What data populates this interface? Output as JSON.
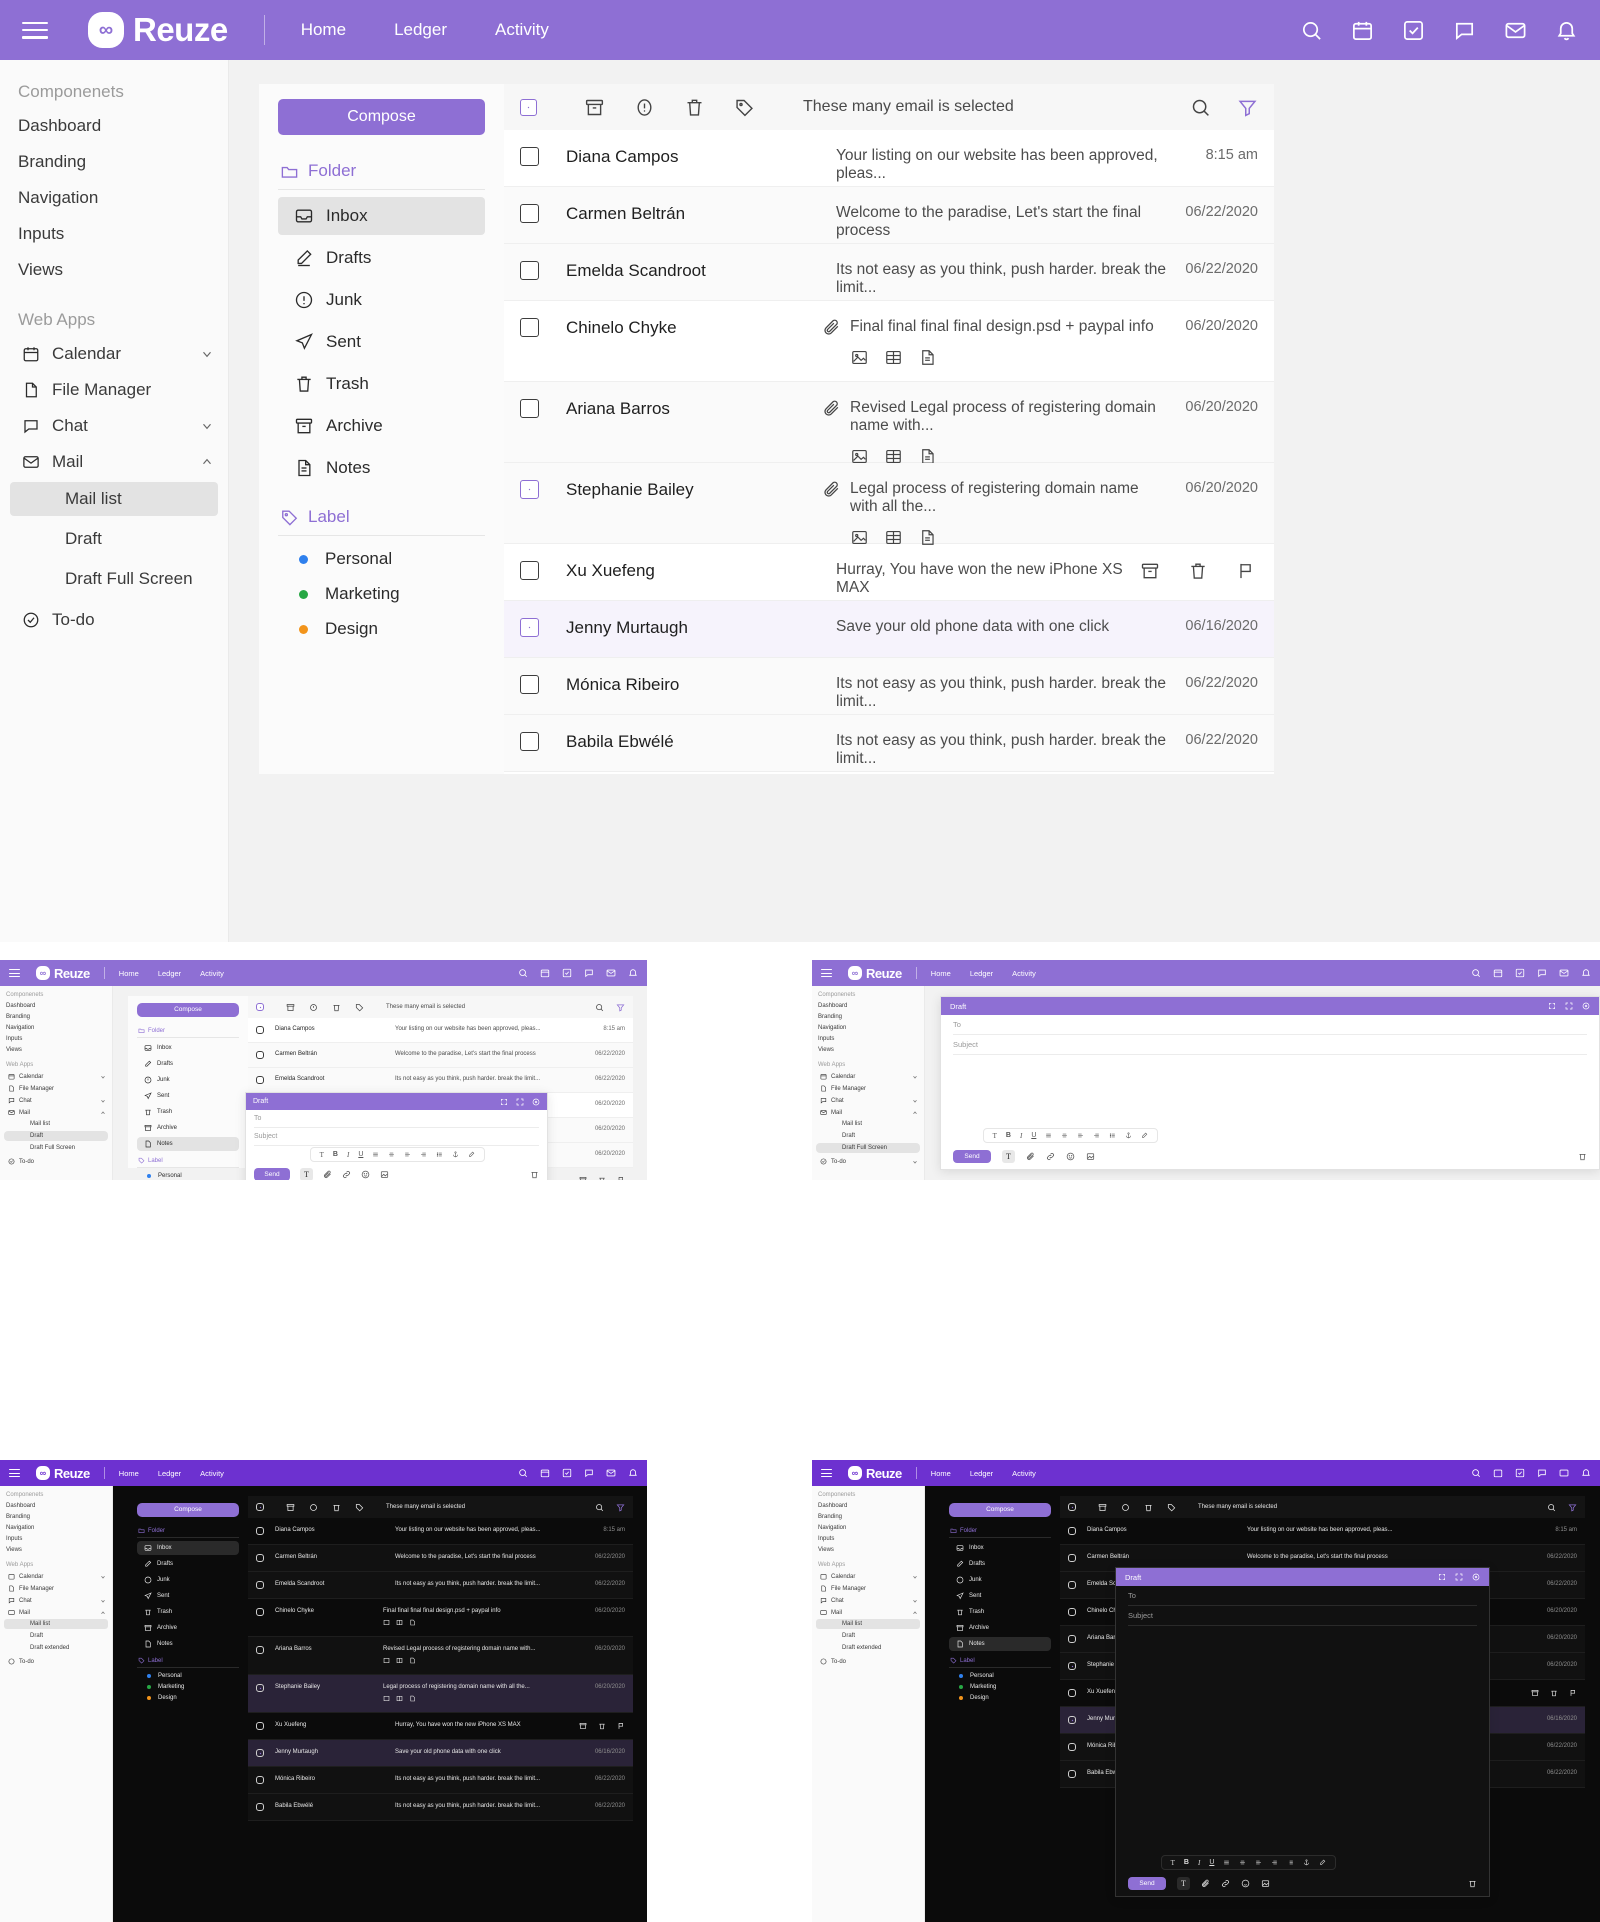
{
  "brand": {
    "name": "Reuze",
    "logo_glyph": "∞",
    "accent": "#8e6fd4",
    "header_bg": "#8e6fd4",
    "dark_header_bg": "#6d31d0"
  },
  "header": {
    "nav": [
      "Home",
      "Ledger",
      "Activity"
    ],
    "icons": [
      "search-icon",
      "calendar-icon",
      "tasks-icon",
      "chat-icon",
      "mail-icon",
      "bell-icon"
    ]
  },
  "sidebar": {
    "section_components": "Componenets",
    "components": [
      "Dashboard",
      "Branding",
      "Navigation",
      "Inputs",
      "Views"
    ],
    "section_webapps": "Web Apps",
    "webapps": [
      {
        "label": "Calendar",
        "icon": "calendar-icon",
        "chevron": "down"
      },
      {
        "label": "File Manager",
        "icon": "file-icon",
        "chevron": "none"
      },
      {
        "label": "Chat",
        "icon": "chat-icon",
        "chevron": "down"
      },
      {
        "label": "Mail",
        "icon": "mail-icon",
        "chevron": "up"
      }
    ],
    "mail_children": [
      "Mail list",
      "Draft",
      "Draft Full Screen"
    ],
    "mail_children_alt": [
      "Mail list",
      "Draft",
      "Draft extended"
    ],
    "todo": {
      "label": "To-do",
      "icon": "check-circle-icon",
      "chevron": "none"
    }
  },
  "mail": {
    "compose_label": "Compose",
    "folder_group": "Folder",
    "folders": [
      {
        "label": "Inbox",
        "icon": "inbox-icon"
      },
      {
        "label": "Drafts",
        "icon": "pencil-icon"
      },
      {
        "label": "Junk",
        "icon": "alert-circle-icon"
      },
      {
        "label": "Sent",
        "icon": "send-icon"
      },
      {
        "label": "Trash",
        "icon": "trash-icon"
      },
      {
        "label": "Archive",
        "icon": "archive-icon"
      },
      {
        "label": "Notes",
        "icon": "notes-icon"
      }
    ],
    "label_group": "Label",
    "labels": [
      {
        "label": "Personal",
        "color": "#2f80ed"
      },
      {
        "label": "Marketing",
        "color": "#27a744"
      },
      {
        "label": "Design",
        "color": "#f2941b"
      }
    ],
    "toolbar": {
      "select_all": "select-all-checkbox",
      "actions": [
        "archive-icon",
        "report-spam-icon",
        "delete-icon",
        "label-icon"
      ],
      "status_text": "These many email is selected",
      "right_actions": [
        "search-icon",
        "filter-icon"
      ]
    },
    "emails": [
      {
        "sender": "Diana Campos",
        "subject": "Your listing on our website has been approved, pleas...",
        "date": "8:15 am",
        "checked": false,
        "attachment": false,
        "selected": false
      },
      {
        "sender": "Carmen Beltrán",
        "subject": "Welcome to the paradise, Let's start the final process",
        "date": "06/22/2020",
        "checked": false,
        "attachment": false,
        "selected": false
      },
      {
        "sender": "Emelda Scandroot",
        "subject": "Its not easy as you think, push harder. break the limit...",
        "date": "06/22/2020",
        "checked": false,
        "attachment": false,
        "selected": false
      },
      {
        "sender": "Chinelo Chyke",
        "subject": "Final final final final design.psd + paypal info",
        "date": "06/20/2020",
        "checked": false,
        "attachment": true,
        "selected": false
      },
      {
        "sender": "Ariana Barros",
        "subject": "Revised Legal process of registering domain name with...",
        "date": "06/20/2020",
        "checked": false,
        "attachment": true,
        "selected": false
      },
      {
        "sender": "Stephanie Bailey",
        "subject": "Legal process of registering domain name with all the...",
        "date": "06/20/2020",
        "checked": true,
        "attachment": true,
        "selected": true
      },
      {
        "sender": "Xu Xuefeng",
        "subject": "Hurray, You have won the new iPhone XS MAX",
        "date": "",
        "checked": false,
        "attachment": false,
        "selected": false,
        "hover_actions": [
          "archive-icon",
          "delete-icon",
          "flag-icon"
        ]
      },
      {
        "sender": "Jenny Murtaugh",
        "subject": "Save your old phone data with one click",
        "date": "06/16/2020",
        "checked": true,
        "attachment": false,
        "selected": true
      },
      {
        "sender": "Mónica Ribeiro",
        "subject": "Its not easy as you think, push harder. break the limit...",
        "date": "06/22/2020",
        "checked": false,
        "attachment": false,
        "selected": false
      },
      {
        "sender": "Babila Ebwélé",
        "subject": "Its not easy as you think, push harder. break the limit...",
        "date": "06/22/2020",
        "checked": false,
        "attachment": false,
        "selected": false
      }
    ],
    "attachment_icons": [
      "image-icon",
      "video-icon",
      "document-icon"
    ]
  },
  "draft": {
    "title": "Draft",
    "window_controls": [
      "minimize-icon",
      "maximize-icon",
      "close-icon"
    ],
    "to_placeholder": "To",
    "subject_placeholder": "Subject",
    "format_tools": [
      "text-icon",
      "bold-icon",
      "italic-icon",
      "underline-icon",
      "align-justify-icon",
      "align-center-icon",
      "align-left-icon",
      "align-right-icon",
      "list-icon",
      "anchor-icon",
      "highlight-icon"
    ],
    "send_label": "Send",
    "bottom_tools": [
      "text-format-icon",
      "attachment-icon",
      "link-icon",
      "emoji-icon",
      "image-icon"
    ],
    "trash_action": "delete-draft-icon"
  }
}
